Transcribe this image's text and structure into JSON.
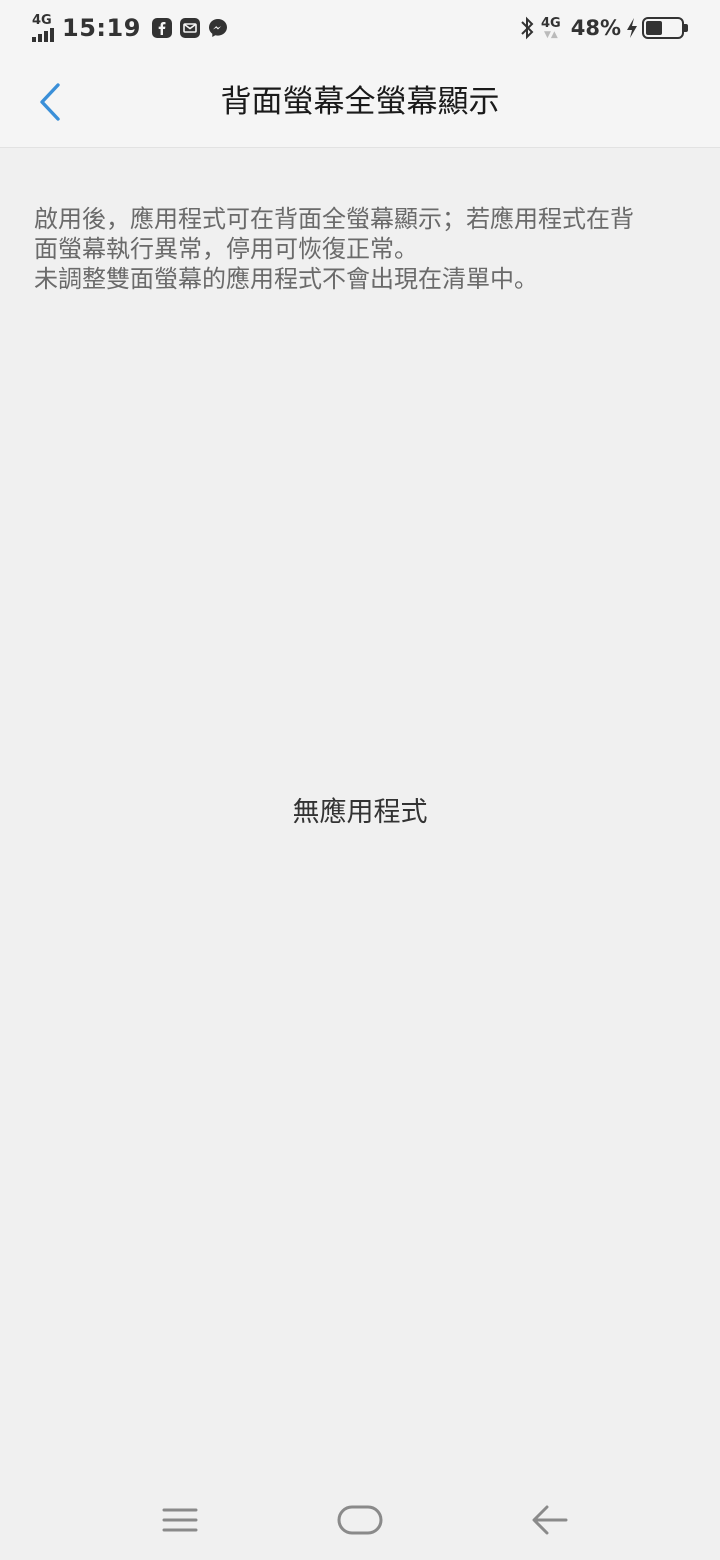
{
  "status_bar": {
    "network_left": "4G",
    "time": "15:19",
    "notifications": [
      "facebook-icon",
      "mail-icon",
      "messenger-icon"
    ],
    "network_right": "4G",
    "battery_percent": "48%",
    "battery_level": 0.48,
    "charging": true
  },
  "header": {
    "title": "背面螢幕全螢幕顯示",
    "back_icon": "chevron-left-icon",
    "accent_color": "#3a8fd8"
  },
  "content": {
    "description_lines": [
      "啟用後，應用程式可在背面全螢幕顯示；若應用程式在背",
      "面螢幕執行異常，停用可恢復正常。",
      "未調整雙面螢幕的應用程式不會出現在清單中。"
    ],
    "empty_text": "無應用程式"
  },
  "nav_bar": {
    "buttons": [
      "menu-icon",
      "home-icon",
      "back-arrow-icon"
    ]
  }
}
